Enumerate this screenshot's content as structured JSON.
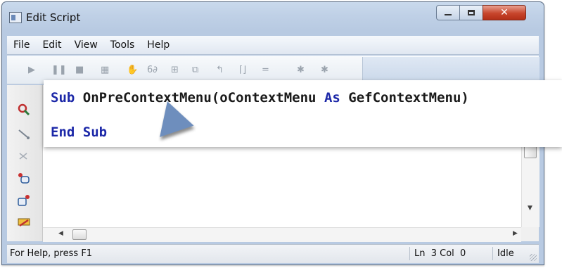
{
  "window": {
    "title": "Edit Script"
  },
  "menu": {
    "items": [
      "File",
      "Edit",
      "View",
      "Tools",
      "Help"
    ]
  },
  "toolbar": {
    "icons": [
      "run-icon",
      "pause-icon",
      "stop-icon",
      "breakpoint-icon",
      "hand-icon",
      "watch-icon",
      "step-into-icon",
      "step-over-icon",
      "step-out-icon",
      "run-to-cursor-icon",
      "toggle-icon",
      "bookmark-icon",
      "clear-bookmark-icon"
    ]
  },
  "sidebar": {
    "icons": [
      "find-icon",
      "wand-icon",
      "cut-icon",
      "object-browser-icon",
      "references-icon",
      "macro-icon"
    ]
  },
  "code": {
    "line1": {
      "keyword": "Sub",
      "rest": " OnPreContextMenu(oContextMenu ",
      "kw2": "As",
      "rest2": " GefContextMenu)"
    },
    "line2": {
      "keyword": "End Sub"
    }
  },
  "status": {
    "help_text": "For Help, press F1",
    "position": "Ln  3 Col  0",
    "state": "Idle"
  },
  "colors": {
    "keyword": "#1c28a8",
    "titlebar": "#c9d9ec",
    "close": "#c7452c"
  }
}
